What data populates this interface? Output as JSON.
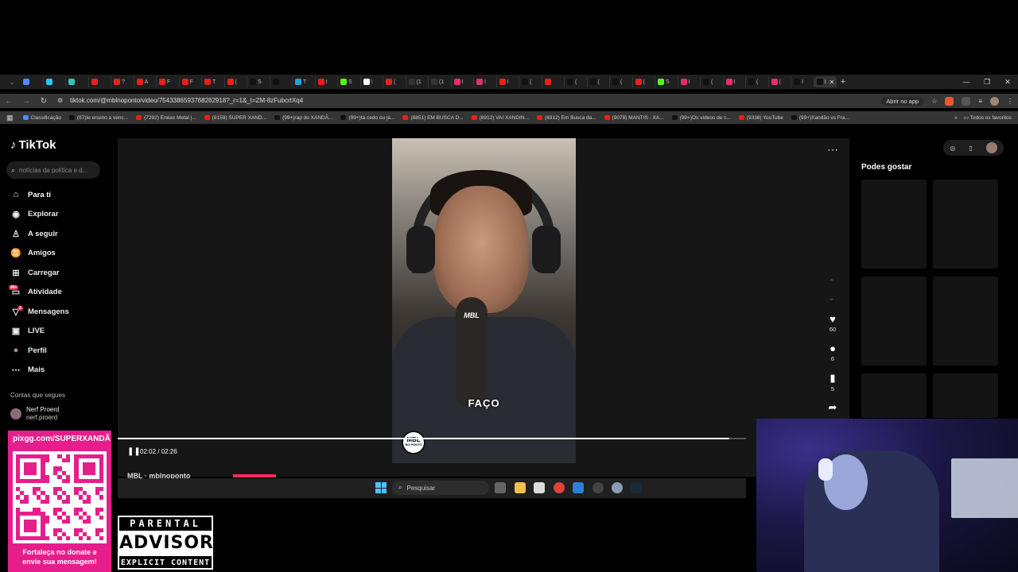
{
  "browser": {
    "url": "tiktok.com/@mblnoponto/video/7543386593768262918?_r=1&_t=ZM-8zFubcrtXq4",
    "open_in_app": "Abrir no app",
    "tabs": [
      {
        "label": "",
        "color": "#4c8bf5"
      },
      {
        "label": "",
        "color": "#33c0ff"
      },
      {
        "label": "",
        "color": "#2ec4b6"
      },
      {
        "label": "",
        "color": "#e62117"
      },
      {
        "label": "?",
        "color": "#e62117"
      },
      {
        "label": "A",
        "color": "#e62117"
      },
      {
        "label": "F",
        "color": "#e62117"
      },
      {
        "label": "F",
        "color": "#e62117"
      },
      {
        "label": "T",
        "color": "#e62117"
      },
      {
        "label": "(",
        "color": "#e62117"
      },
      {
        "label": "S",
        "color": "#111111"
      },
      {
        "label": "",
        "color": "#111111"
      },
      {
        "label": "T",
        "color": "#2aa0e0"
      },
      {
        "label": "I",
        "color": "#e62117"
      },
      {
        "label": "S",
        "color": "#53fc18"
      },
      {
        "label": "\\",
        "color": "#ffffff"
      },
      {
        "label": "(",
        "color": "#e62117"
      },
      {
        "label": "(1",
        "color": "#333333"
      },
      {
        "label": "(1",
        "color": "#333333"
      },
      {
        "label": "I",
        "color": "#e1306c"
      },
      {
        "label": "I",
        "color": "#e1306c"
      },
      {
        "label": "I",
        "color": "#e62117"
      },
      {
        "label": "(",
        "color": "#111111"
      },
      {
        "label": "",
        "color": "#e62117"
      },
      {
        "label": "(",
        "color": "#111111"
      },
      {
        "label": "(",
        "color": "#111111"
      },
      {
        "label": "(",
        "color": "#111111"
      },
      {
        "label": "(",
        "color": "#e62117"
      },
      {
        "label": "S",
        "color": "#53fc18"
      },
      {
        "label": "I",
        "color": "#e1306c"
      },
      {
        "label": "(",
        "color": "#111111"
      },
      {
        "label": "I",
        "color": "#e1306c"
      },
      {
        "label": "(",
        "color": "#111111"
      },
      {
        "label": "(",
        "color": "#e1306c"
      },
      {
        "label": "I",
        "color": "#111111"
      },
      {
        "label": "I",
        "color": "#111111"
      }
    ],
    "bookmarks": [
      {
        "label": "Classificação",
        "color": "#4c8bf5"
      },
      {
        "label": "(97)Ie ensino a venc...",
        "color": "#111111"
      },
      {
        "label": "(7292) Enéas Metal |...",
        "color": "#e62117"
      },
      {
        "label": "(8159) SUPER XAND...",
        "color": "#e62117"
      },
      {
        "label": "(99+)rap do XANDÃ...",
        "color": "#111111"
      },
      {
        "label": "(99+)tá cedo ou já...",
        "color": "#111111"
      },
      {
        "label": "(8851) EM BUSCA D...",
        "color": "#e62117"
      },
      {
        "label": "(8912) VAI XANDIN...",
        "color": "#e62117"
      },
      {
        "label": "(8912) Em Busca da...",
        "color": "#e62117"
      },
      {
        "label": "(9078) MANTIS - XA...",
        "color": "#e62117"
      },
      {
        "label": "(99+)Os vídeos de c...",
        "color": "#111111"
      },
      {
        "label": "(9338) YouTube",
        "color": "#e62117"
      },
      {
        "label": "(99+)Xandão vs Fra...",
        "color": "#111111"
      }
    ],
    "all_favorites": "Todos os favoritos"
  },
  "tiktok": {
    "logo": "TikTok",
    "search_placeholder": "notícias da política e d...",
    "nav": [
      {
        "label": "Para ti",
        "icon": "home-icon"
      },
      {
        "label": "Explorar",
        "icon": "compass-icon"
      },
      {
        "label": "A seguir",
        "icon": "user-follow-icon"
      },
      {
        "label": "Amigos",
        "icon": "friends-icon"
      },
      {
        "label": "Carregar",
        "icon": "upload-icon"
      },
      {
        "label": "Atividade",
        "icon": "inbox-icon",
        "badge": "99+"
      },
      {
        "label": "Mensagens",
        "icon": "message-icon",
        "badge": "3"
      },
      {
        "label": "LIVE",
        "icon": "live-icon"
      },
      {
        "label": "Perfil",
        "icon": "profile-icon"
      },
      {
        "label": "Mais",
        "icon": "more-icon"
      }
    ],
    "following_header": "Contas que segues",
    "following_account": {
      "name": "Nerf Proerd",
      "handle": "nerf.proerd"
    },
    "video": {
      "caption": "FAÇO",
      "mic_badge": "MBL",
      "logo_top": "MBL",
      "logo_bottom": "NO PONTO",
      "time": "02:02 / 02:26",
      "progress": 0.973,
      "author": "MBL · mblnoponto"
    },
    "actions": {
      "likes": "60",
      "comments": "6",
      "saves": "5"
    },
    "recommendations_title": "Podes gostar"
  },
  "taskbar": {
    "search": "Pesquisar"
  },
  "overlay": {
    "pix_url": "pixgg.com/SUPERXANDÃ",
    "pix_footer_1": "Fortaleça no donate e",
    "pix_footer_2": "envie sua mensagem!",
    "advisory_top": "PARENTAL",
    "advisory_mid": "ADVISORY",
    "advisory_bot": "EXPLICIT CONTENT"
  },
  "colors": {
    "accent": "#fe2c55",
    "pix": "#e61e8c",
    "windows_blue": "#4cc2ff"
  }
}
